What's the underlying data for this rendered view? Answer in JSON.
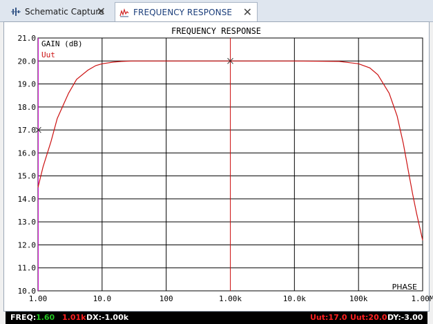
{
  "tabs": [
    {
      "label": "Schematic Capture",
      "icon": "schematic-icon",
      "active": false
    },
    {
      "label": "FREQUENCY RESPONSE",
      "icon": "graph-icon",
      "active": true
    }
  ],
  "colors": {
    "trace": "#cc1111",
    "cursor_x": "#cc00cc",
    "green": "#22c422",
    "red": "#ff2020"
  },
  "chart_data": {
    "type": "line",
    "title": "FREQUENCY RESPONSE",
    "ylabel": "GAIN (dB)",
    "trace_label": "Uut",
    "phase_label": "PHASE",
    "x_scale": "log",
    "xlim": [
      1,
      1000000
    ],
    "ylim": [
      10,
      21
    ],
    "yticks": [
      "21.0",
      "20.0",
      "19.0",
      "18.0",
      "17.0",
      "16.0",
      "15.0",
      "14.0",
      "13.0",
      "12.0",
      "11.0",
      "10.0"
    ],
    "xticks": [
      "1.00",
      "10.0",
      "100",
      "1.00k",
      "10.0k",
      "100k",
      "1.00M"
    ],
    "grid": true,
    "series": [
      {
        "name": "Uut",
        "x": [
          1,
          1.2,
          1.6,
          2,
          3,
          4,
          6,
          8,
          10,
          15,
          20,
          30,
          50,
          100,
          1000,
          10000,
          50000,
          100000,
          150000,
          200000,
          300000,
          400000,
          500000,
          600000,
          700000,
          800000,
          1000000
        ],
        "y": [
          14.5,
          15.4,
          16.5,
          17.5,
          18.6,
          19.2,
          19.6,
          19.8,
          19.88,
          19.95,
          19.98,
          20.0,
          20.0,
          20.0,
          20.0,
          20.0,
          19.98,
          19.88,
          19.7,
          19.4,
          18.6,
          17.6,
          16.4,
          15.2,
          14.2,
          13.4,
          12.2
        ]
      }
    ],
    "cursors": {
      "x1": 1.01,
      "x2": 1000
    }
  },
  "status": {
    "freq_label": "FREQ:",
    "freq_value": "1.60",
    "freq_red": "1.01k",
    "dx": "DX:-1.00k",
    "uut1": "Uut:17.0",
    "uut2": "Uut:20.0",
    "dy": "DY:-3.00"
  }
}
